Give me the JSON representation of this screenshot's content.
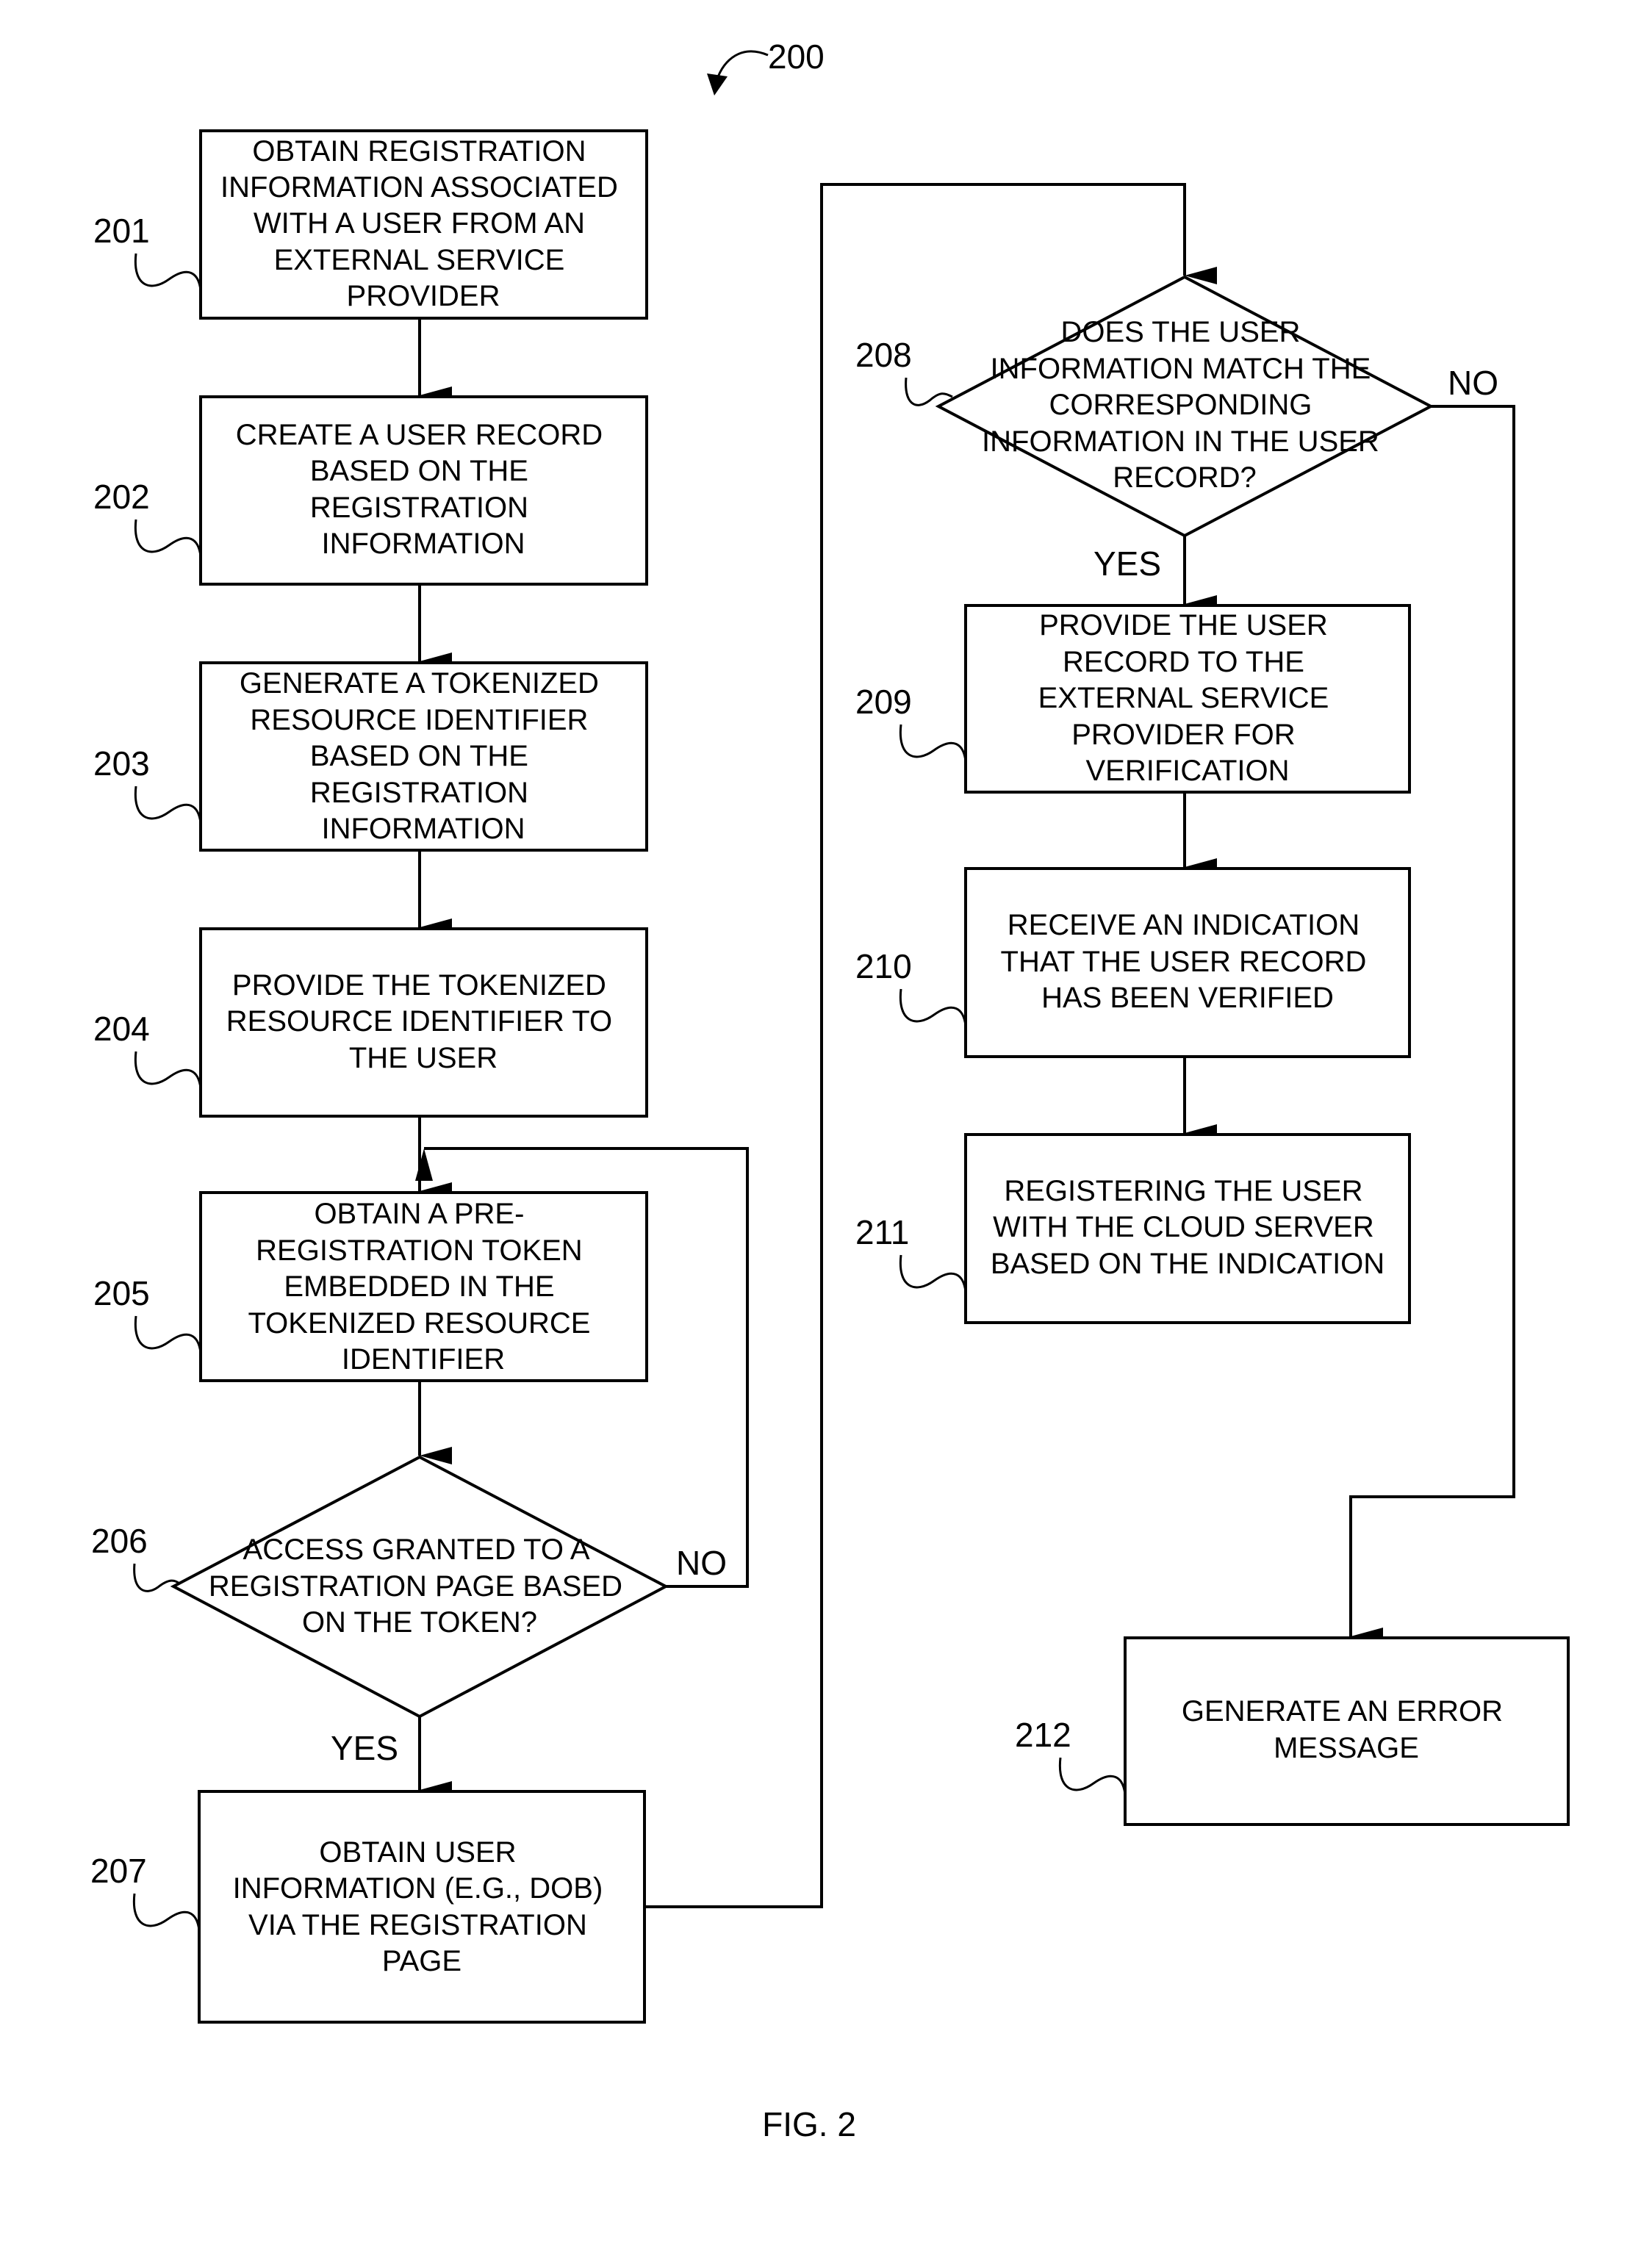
{
  "figure": {
    "ref": "200",
    "caption": "FIG. 2"
  },
  "steps": {
    "s201": {
      "ref": "201",
      "lines": [
        "OBTAIN REGISTRATION",
        "INFORMATION ASSOCIATED",
        "WITH A USER FROM AN",
        "EXTERNAL SERVICE",
        "PROVIDER"
      ]
    },
    "s202": {
      "ref": "202",
      "lines": [
        "CREATE A USER RECORD",
        "BASED ON THE",
        "REGISTRATION",
        "INFORMATION"
      ]
    },
    "s203": {
      "ref": "203",
      "lines": [
        "GENERATE A TOKENIZED",
        "RESOURCE IDENTIFIER",
        "BASED ON THE",
        "REGISTRATION",
        "INFORMATION"
      ]
    },
    "s204": {
      "ref": "204",
      "lines": [
        "PROVIDE THE TOKENIZED",
        "RESOURCE IDENTIFIER TO",
        "THE USER"
      ]
    },
    "s205": {
      "ref": "205",
      "lines": [
        "OBTAIN A PRE-",
        "REGISTRATION TOKEN",
        "EMBEDDED IN THE",
        "TOKENIZED RESOURCE",
        "IDENTIFIER"
      ]
    },
    "s206": {
      "ref": "206",
      "lines": [
        "ACCESS GRANTED TO A",
        "REGISTRATION PAGE BASED",
        "ON THE TOKEN?"
      ],
      "yes": "YES",
      "no": "NO"
    },
    "s207": {
      "ref": "207",
      "lines": [
        "OBTAIN USER",
        "INFORMATION (E.G., DOB)",
        "VIA THE REGISTRATION",
        "PAGE"
      ]
    },
    "s208": {
      "ref": "208",
      "lines": [
        "DOES THE USER",
        "INFORMATION MATCH THE",
        "CORRESPONDING",
        "INFORMATION IN THE USER",
        "RECORD?"
      ],
      "yes": "YES",
      "no": "NO"
    },
    "s209": {
      "ref": "209",
      "lines": [
        "PROVIDE THE USER",
        "RECORD TO THE",
        "EXTERNAL SERVICE",
        "PROVIDER FOR",
        "VERIFICATION"
      ]
    },
    "s210": {
      "ref": "210",
      "lines": [
        "RECEIVE AN INDICATION",
        "THAT THE USER RECORD",
        "HAS BEEN VERIFIED"
      ]
    },
    "s211": {
      "ref": "211",
      "lines": [
        "REGISTERING THE USER",
        "WITH THE CLOUD SERVER",
        "BASED ON THE INDICATION"
      ]
    },
    "s212": {
      "ref": "212",
      "lines": [
        "GENERATE AN ERROR",
        "MESSAGE"
      ]
    }
  }
}
